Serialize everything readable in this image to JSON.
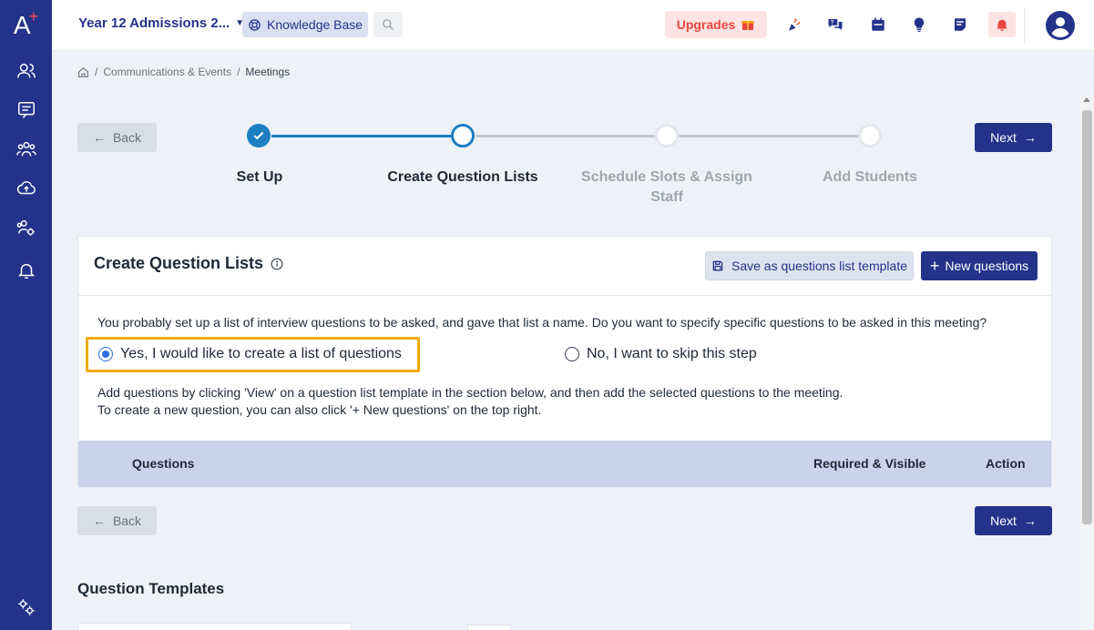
{
  "brand": {
    "logo_text": "A",
    "logo_plus": "+"
  },
  "colors": {
    "primary": "#24338a",
    "accent_blue": "#1b7fc1",
    "highlight": "#f0ab0a",
    "alert": "#e8463f",
    "inactive_step": "#c4c8d0"
  },
  "sidebar": {
    "items": [
      {
        "icon": "users-icon"
      },
      {
        "icon": "chat-icon"
      },
      {
        "icon": "groups-icon"
      },
      {
        "icon": "cloud-upload-icon"
      },
      {
        "icon": "user-settings-icon"
      },
      {
        "icon": "bell-icon"
      }
    ],
    "footer_icon": "settings-gears-icon"
  },
  "header": {
    "app_switcher": "Year 12 Admissions 2...",
    "knowledge_base": "Knowledge Base",
    "upgrades": "Upgrades",
    "icons": [
      "confetti-icon",
      "help-chat-icon",
      "calendar-icon",
      "lightbulb-icon",
      "notes-icon",
      "notification-alert-icon"
    ],
    "avatar_icon": "user-avatar-icon"
  },
  "breadcrumb": {
    "section": "Communications & Events",
    "separator": "/",
    "current": "Meetings"
  },
  "nav": {
    "back_label": "Back",
    "next_label": "Next"
  },
  "stepper": {
    "steps": [
      {
        "label": "Set Up",
        "state": "complete"
      },
      {
        "label": "Create Question Lists",
        "state": "active"
      },
      {
        "label": "Schedule Slots & Assign Staff",
        "state": "pending"
      },
      {
        "label": "Add Students",
        "state": "pending"
      }
    ]
  },
  "card": {
    "title": "Create Question Lists",
    "save_template_label": "Save as questions list template",
    "new_questions_label": "New questions",
    "intro": "You probably set up a list of interview questions to be asked, and gave that list a name. Do you want to specify specific questions to be asked in this meeting?",
    "options": [
      {
        "label": "Yes, I would like to create a list of questions",
        "checked": true
      },
      {
        "label": "No, I want to skip this step",
        "checked": false
      }
    ],
    "hint_line1": "Add questions by clicking 'View' on a question list template in the section below, and then add the selected questions to the meeting.",
    "hint_line2": "To create a new question, you can also click '+ New questions' on the top right.",
    "table_headers": {
      "questions": "Questions",
      "required_visible": "Required & Visible",
      "action": "Action"
    }
  },
  "templates_section_title": "Question Templates"
}
